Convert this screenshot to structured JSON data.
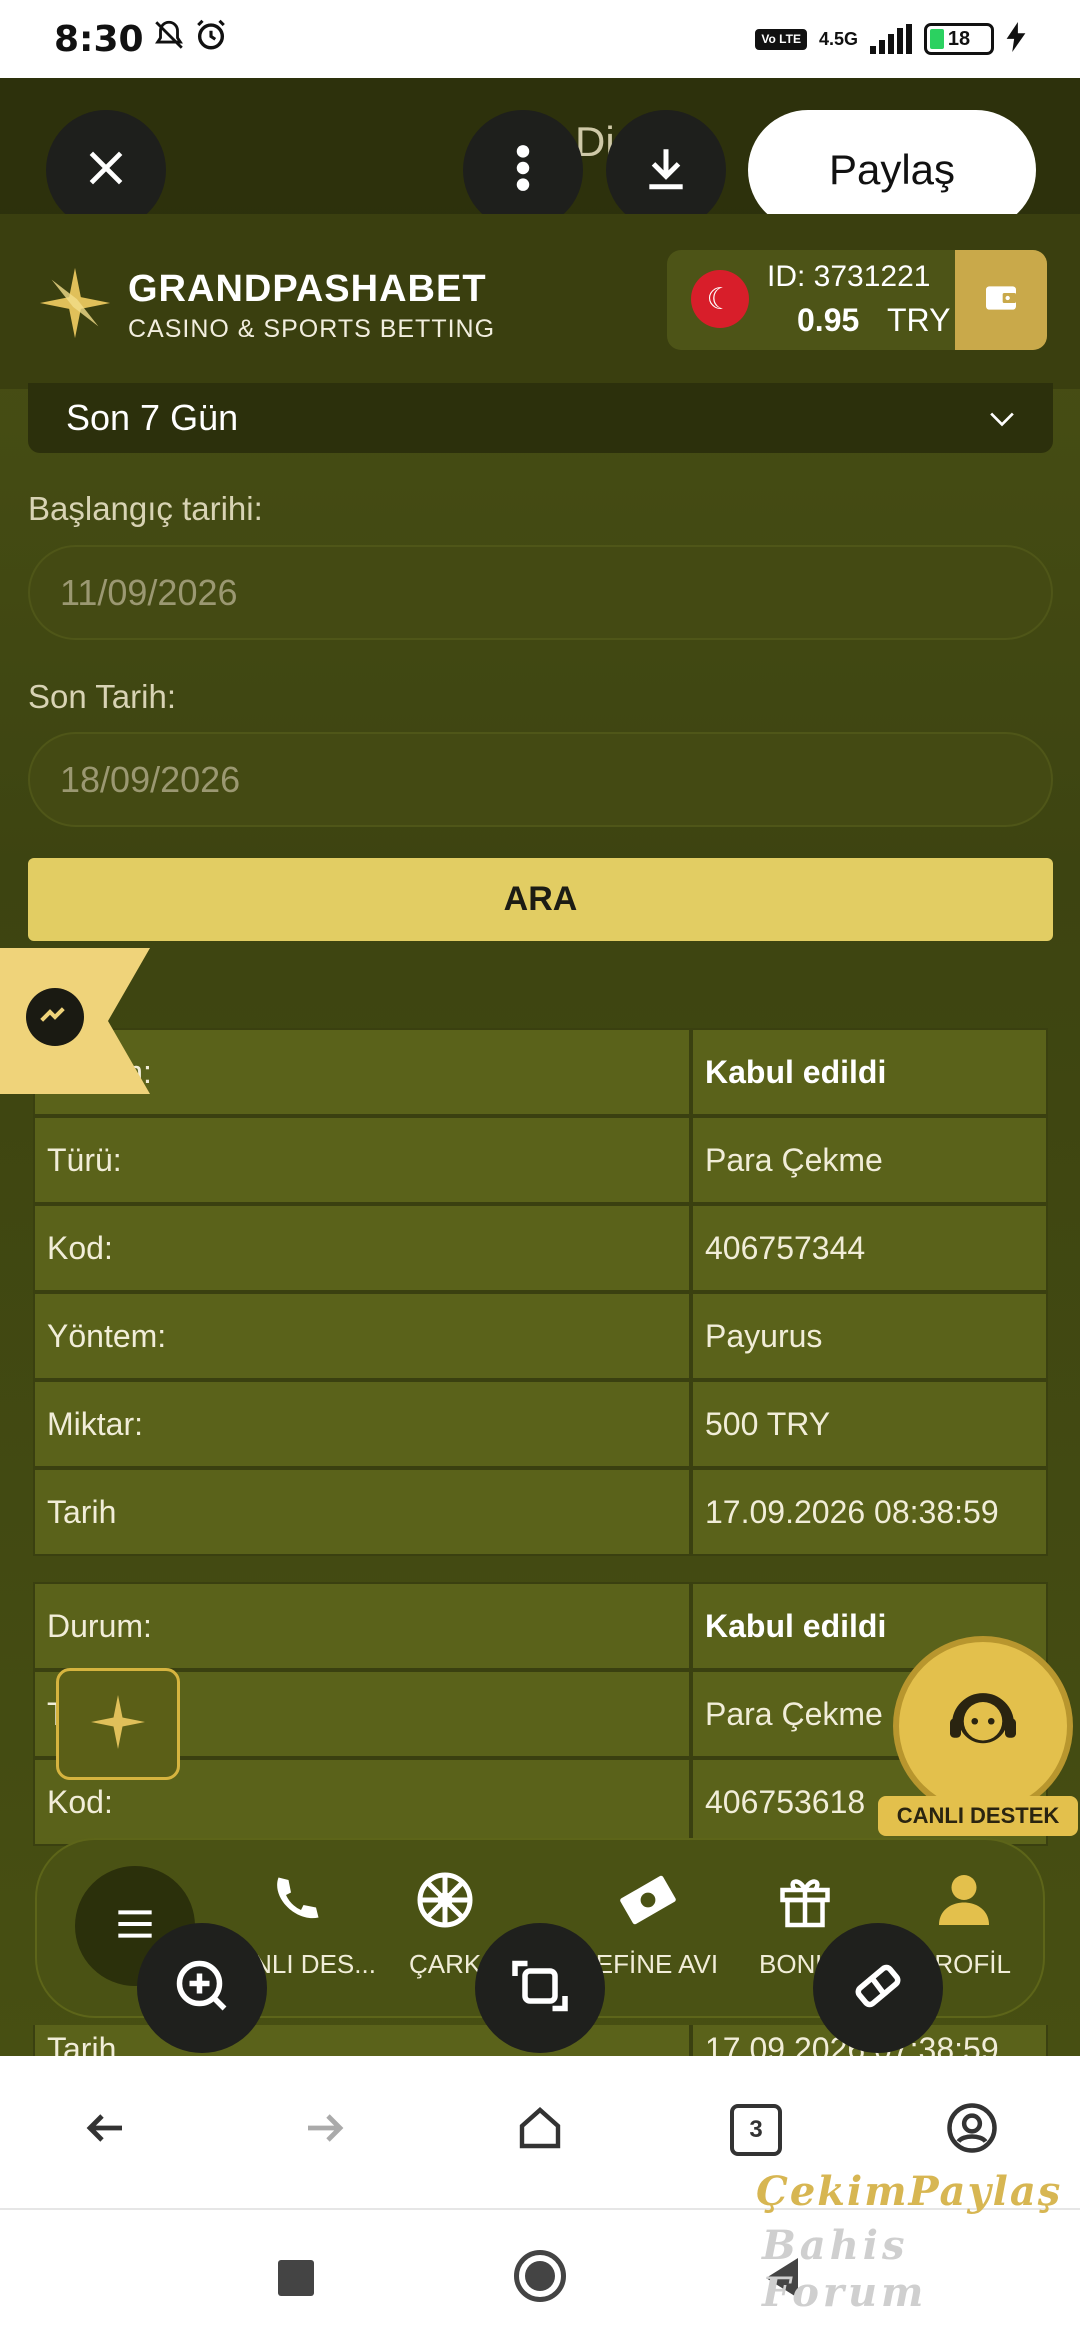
{
  "status_bar": {
    "time": "8:30",
    "network": "4.5G",
    "volte": "Vo LTE",
    "battery": "18"
  },
  "share_overlay": {
    "title": "Di... ini",
    "share_label": "Paylaş"
  },
  "header": {
    "brand": "GRANDPASHABET",
    "tagline": "CASINO & SPORTS BETTING",
    "account_id": "ID: 3731221",
    "balance": "0.95",
    "currency": "TRY"
  },
  "filter": {
    "period": "Son 7 Gün",
    "start_label": "Başlangıç tarihi:",
    "start_value": "11/09/2026",
    "end_label": "Son Tarih:",
    "end_value": "18/09/2026",
    "search_label": "ARA"
  },
  "transactions": [
    {
      "rows": [
        {
          "key": "Durum:",
          "value": "Kabul edildi",
          "bold": true
        },
        {
          "key": "Türü:",
          "value": "Para Çekme"
        },
        {
          "key": "Kod:",
          "value": "406757344"
        },
        {
          "key": "Yöntem:",
          "value": "Payurus"
        },
        {
          "key": "Miktar:",
          "value": "500 TRY"
        },
        {
          "key": "Tarih",
          "value": "17.09.2026 08:38:59"
        }
      ]
    },
    {
      "rows": [
        {
          "key": "Durum:",
          "value": "Kabul edildi",
          "bold": true
        },
        {
          "key": "Türü:",
          "value": "Para Çekme"
        },
        {
          "key": "Kod:",
          "value": "406753618"
        }
      ]
    }
  ],
  "partial_row": {
    "key": "Tarih",
    "value": "17.09.2026 07:38:59"
  },
  "support_label": "CANLI DESTEK",
  "site_nav": [
    {
      "label": "CANLI DES...",
      "icon": "phone-icon"
    },
    {
      "label": "ÇARK",
      "icon": "wheel-icon"
    },
    {
      "label": "DEFİNE AVI",
      "icon": "money-icon"
    },
    {
      "label": "BONUS",
      "icon": "gift-icon"
    },
    {
      "label": "PROFİL",
      "icon": "user-icon"
    }
  ],
  "browser": {
    "tab_count": "3"
  },
  "watermark": {
    "line1": "ÇekimPaylaş",
    "line2": "Bahis Forum"
  }
}
